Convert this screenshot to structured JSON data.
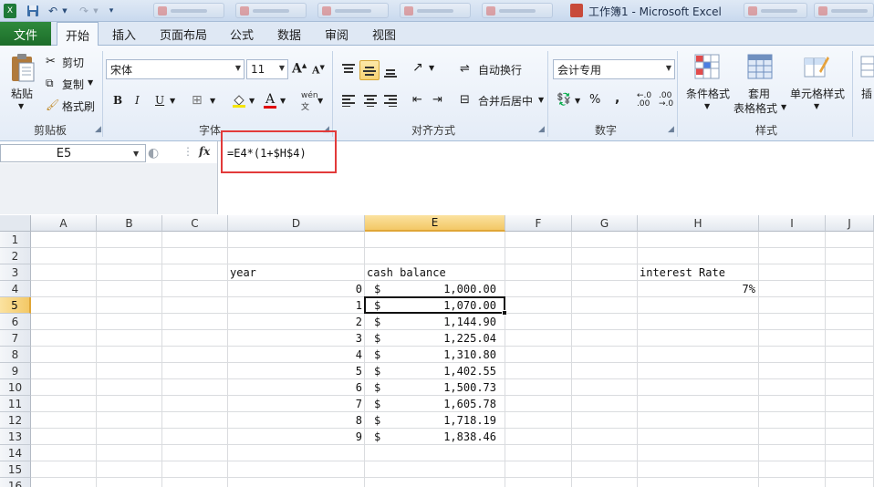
{
  "window": {
    "title": "工作簿1 - Microsoft Excel"
  },
  "ribbon_tabs": [
    "文件",
    "开始",
    "插入",
    "页面布局",
    "公式",
    "数据",
    "审阅",
    "视图"
  ],
  "clipboard": {
    "paste": "粘贴",
    "cut": "剪切",
    "copy": "复制",
    "format_painter": "格式刷",
    "group": "剪贴板"
  },
  "font": {
    "name": "宋体",
    "size": "11",
    "group": "字体",
    "bold": "B",
    "italic": "I",
    "underline": "U"
  },
  "alignment": {
    "wrap_text": "自动换行",
    "merge_center": "合并后居中",
    "group": "对齐方式"
  },
  "number": {
    "format": "会计专用",
    "percent": "%",
    "comma": ",",
    "group": "数字"
  },
  "styles": {
    "conditional": "条件格式",
    "table_line1": "套用",
    "table_line2": "表格格式",
    "cell_styles": "单元格样式",
    "group": "样式"
  },
  "cells_group": {
    "insert": "插"
  },
  "formula_bar": {
    "name_box": "E5",
    "fx": "fx",
    "formula": "=E4*(1+$H$4)"
  },
  "columns": [
    "A",
    "B",
    "C",
    "D",
    "E",
    "F",
    "G",
    "H",
    "I",
    "J"
  ],
  "rows": [
    "1",
    "2",
    "3",
    "4",
    "5",
    "6",
    "7",
    "8",
    "9",
    "10",
    "11",
    "12",
    "13",
    "14",
    "15",
    "16"
  ],
  "sheet": {
    "headers": {
      "year": "year",
      "cash_balance": "cash balance",
      "interest_rate": "interest Rate"
    },
    "interest_rate_value": "7%",
    "currency_symbol": "$",
    "data": [
      {
        "year": "0",
        "balance": "1,000.00"
      },
      {
        "year": "1",
        "balance": "1,070.00"
      },
      {
        "year": "2",
        "balance": "1,144.90"
      },
      {
        "year": "3",
        "balance": "1,225.04"
      },
      {
        "year": "4",
        "balance": "1,310.80"
      },
      {
        "year": "5",
        "balance": "1,402.55"
      },
      {
        "year": "6",
        "balance": "1,500.73"
      },
      {
        "year": "7",
        "balance": "1,605.78"
      },
      {
        "year": "8",
        "balance": "1,718.19"
      },
      {
        "year": "9",
        "balance": "1,838.46"
      }
    ]
  },
  "selection": {
    "cell": "E5",
    "column": "E",
    "row": "5"
  }
}
